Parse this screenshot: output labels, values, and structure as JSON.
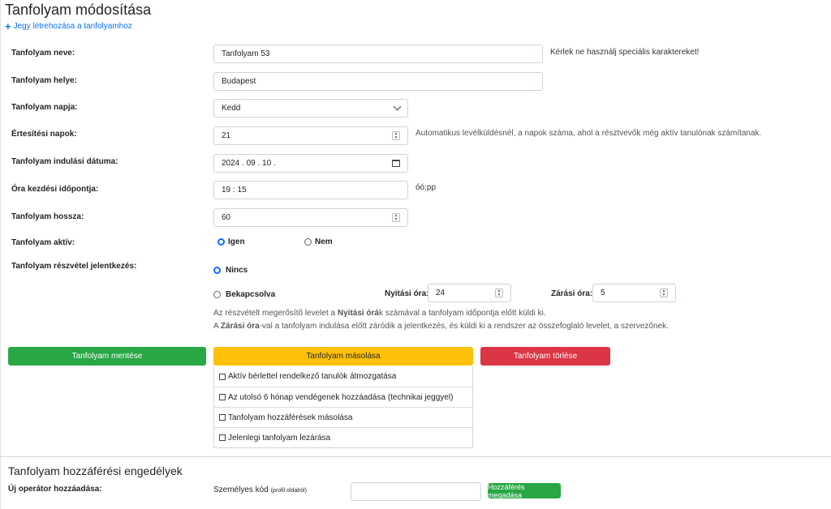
{
  "page": {
    "title": "Tanfolyam módosítása",
    "ticket_link": "Jegy létrehozása a tanfolyamhoz"
  },
  "form": {
    "name": {
      "label": "Tanfolyam neve:",
      "value": "Tanfolyam 53",
      "hint": "Kérlek ne használj speciális karaktereket!"
    },
    "location": {
      "label": "Tanfolyam helye:",
      "value": "Budapest"
    },
    "day": {
      "label": "Tanfolyam napja:",
      "value": "Kedd"
    },
    "notify_days": {
      "label": "Értesítési napok:",
      "value": "21",
      "hint": "Automatikus levélküldésnél, a napok száma, ahol a résztvevők még aktív tanulónak számítanak."
    },
    "start_date": {
      "label": "Tanfolyam indulási dátuma:",
      "value": "2024 . 09 . 10 ."
    },
    "start_time": {
      "label": "Óra kezdési időpontja:",
      "value": "19 : 15",
      "hint": "óó:pp"
    },
    "duration": {
      "label": "Tanfolyam hossza:",
      "value": "60"
    },
    "active": {
      "label": "Tanfolyam aktív:",
      "yes": "Igen",
      "no": "Nem",
      "selected": "Igen"
    },
    "attendance": {
      "label": "Tanfolyam részvétel jelentkezés:",
      "opt_none": "Nincs",
      "opt_on": "Bekapcsolva",
      "selected": "Nincs",
      "open_label": "Nyitási óra:",
      "open_value": "24",
      "close_label": "Zárási óra:",
      "close_value": "5",
      "info1_a": "Az részvételt megerősítő levelet a ",
      "info1_b": "Nyitási órá",
      "info1_c": "k számával a tanfolyam időpontja előtt küldi ki.",
      "info2_a": "A ",
      "info2_b": "Zárási óra",
      "info2_c": "-val a tanfolyam indulása előtt záródik a jelentkezés, és küldi ki a rendszer az összefoglaló levelet, a szervezőnek."
    }
  },
  "actions": {
    "save": "Tanfolyam mentése",
    "copy": "Tanfolyam másolása",
    "delete": "Tanfolyam törlése",
    "copy_options": [
      "Aktív bérlettel rendelkező tanulók átmozgatása",
      "Az utolsó 6 hónap vendégenek hozzáadása (technikai jeggyel)",
      "Tanfolyam hozzáférések másolása",
      "Jelenlegi tanfolyam lezárása"
    ]
  },
  "access": {
    "title": "Tanfolyam hozzáférési engedélyek",
    "new_operator_label": "Új operátor hozzáadása:",
    "personal_code_label": "Személyes kód",
    "personal_code_sub": "(profil oldalról)",
    "code_value": "",
    "grant_button": "Hozzáférés megadása"
  },
  "colors": {
    "save": "#28a745",
    "copy": "#ffc107",
    "delete": "#dc3545",
    "link": "#0d6efd"
  }
}
